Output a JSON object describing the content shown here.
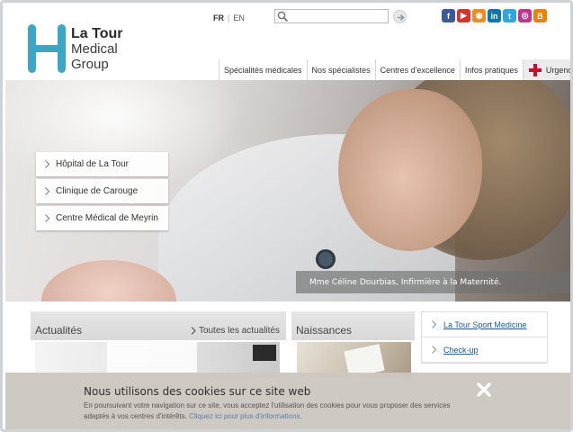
{
  "brand": {
    "line1": "La Tour",
    "line2": "Medical",
    "line3": "Group",
    "color": "#3aa7c9"
  },
  "languages": {
    "fr": "FR",
    "separator": "|",
    "en": "EN"
  },
  "search": {
    "value": "",
    "placeholder": ""
  },
  "social": [
    {
      "icon": "facebook-icon",
      "glyph": "f",
      "color": "#3b5998"
    },
    {
      "icon": "youtube-icon",
      "glyph": "▶",
      "color": "#d9312e"
    },
    {
      "icon": "rss-icon",
      "glyph": "◉",
      "color": "#f08a24"
    },
    {
      "icon": "linkedin-icon",
      "glyph": "in",
      "color": "#0e76a8"
    },
    {
      "icon": "twitter-icon",
      "glyph": "t",
      "color": "#2ea8e5"
    },
    {
      "icon": "instagram-icon",
      "glyph": "◎",
      "color": "#c1358f"
    },
    {
      "icon": "blogger-icon",
      "glyph": "B",
      "color": "#f57d00"
    }
  ],
  "nav": {
    "items": [
      "Spécialités médicales",
      "Nos spécialistes",
      "Centres d'excellence",
      "Infos pratiques"
    ],
    "emergency": "Urgences",
    "emergency_color": "#c8102e"
  },
  "hero": {
    "locations": [
      "Hôpital de La Tour",
      "Clinique de Carouge",
      "Centre Médical de Meyrin"
    ],
    "caption": "Mme Céline Dourbias, Infirmière à la Maternité."
  },
  "news": {
    "title": "Actualités",
    "all_link": "Toutes les actualités"
  },
  "births": {
    "title": "Naissances"
  },
  "side_links": [
    "La Tour Sport Medicine",
    "Check-up"
  ],
  "cookie": {
    "title": "Nous utilisons des cookies sur ce site web",
    "body": "En poursuivant votre navigation sur ce site, vous acceptez l'utilisation des cookies pour vous proposer des services adaptés à vos centres d'intérêts.",
    "link": "Cliquez ici pour plus d'informations."
  }
}
